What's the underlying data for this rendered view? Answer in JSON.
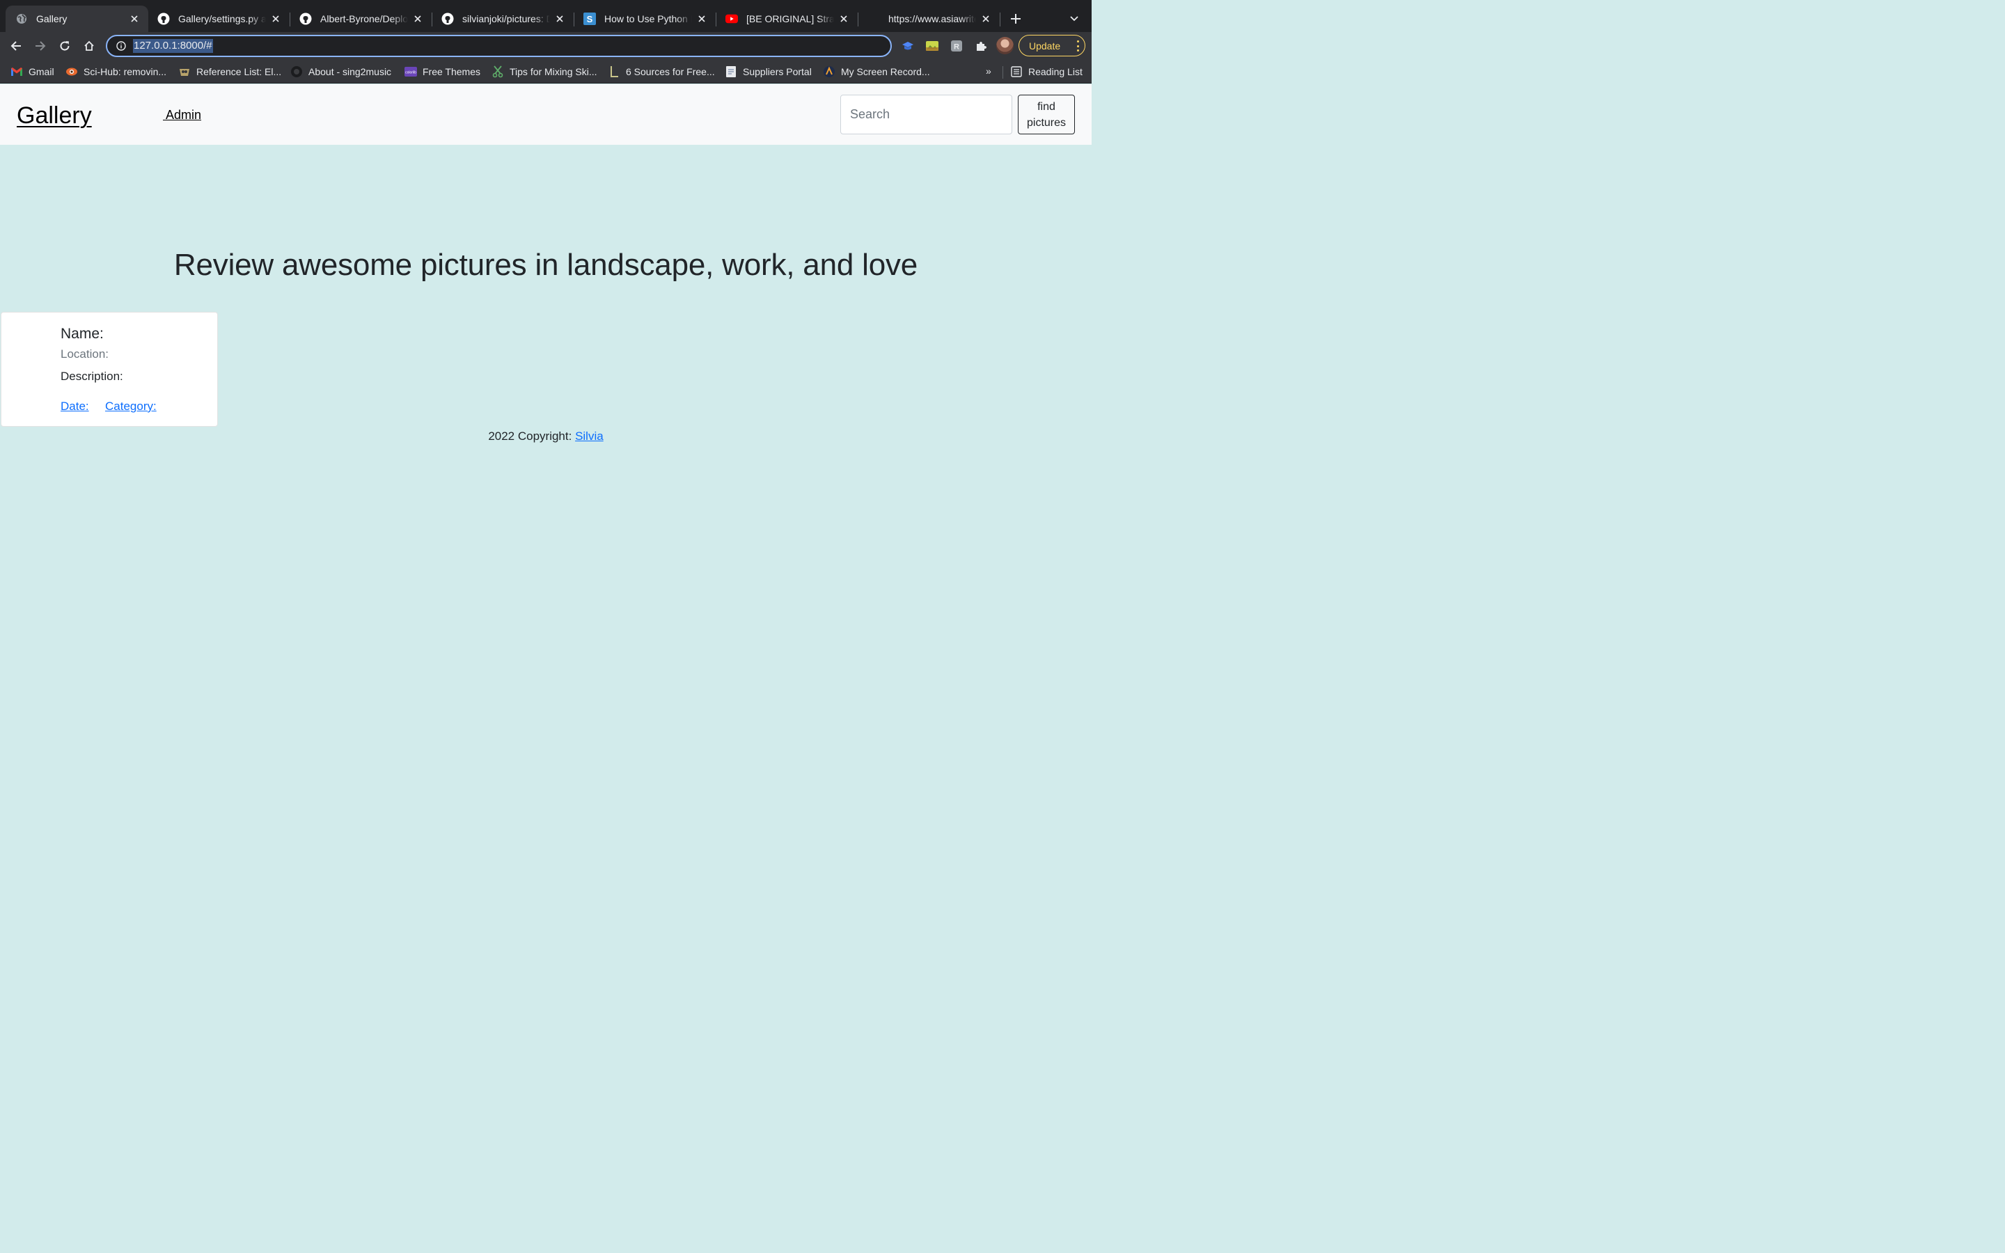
{
  "browser": {
    "tabs": [
      {
        "title": "Gallery",
        "icon": "globe-icon",
        "active": true
      },
      {
        "title": "Gallery/settings.py at",
        "icon": "github-icon"
      },
      {
        "title": "Albert-Byrone/Deploy",
        "icon": "github-icon"
      },
      {
        "title": "silvianjoki/pictures: Dj",
        "icon": "github-icon"
      },
      {
        "title": "How to Use Python D",
        "icon": "s-icon"
      },
      {
        "title": "[BE ORIGINAL] Stray",
        "icon": "youtube-icon"
      },
      {
        "title": "https://www.asiawrite",
        "icon": "blank-icon"
      }
    ],
    "url": "127.0.0.1:8000/#",
    "update_label": "Update",
    "bookmarks": [
      {
        "label": "Gmail",
        "icon": "gmail-icon"
      },
      {
        "label": "Sci-Hub: removin...",
        "icon": "scihub-icon"
      },
      {
        "label": "Reference List: El...",
        "icon": "owl-icon"
      },
      {
        "label": "About - sing2music",
        "icon": "circle-icon"
      },
      {
        "label": "Free Themes",
        "icon": "colorlib-icon"
      },
      {
        "label": "Tips for Mixing Ski...",
        "icon": "scissors-icon"
      },
      {
        "label": "6 Sources for Free...",
        "icon": "l-icon"
      },
      {
        "label": "Suppliers Portal",
        "icon": "doc-icon"
      },
      {
        "label": "My Screen Record...",
        "icon": "record-icon"
      }
    ],
    "bookmarks_more": "»",
    "reading_list": "Reading List"
  },
  "page": {
    "brand": "Gallery",
    "admin_link": " Admin",
    "search_placeholder": "Search",
    "find_button": "find pictures",
    "hero_title": "Review awesome pictures in landscape, work, and love",
    "card": {
      "name_label": "Name:",
      "location_label": "Location:",
      "description_label": "Description:",
      "date_link": "Date:",
      "category_link": "Category:"
    },
    "footer": {
      "text": "2022 Copyright: ",
      "author": "Silvia"
    }
  },
  "colors": {
    "page_bg": "#d2ebeb",
    "navbar_bg": "#f8f9fa",
    "link": "#0d6efd",
    "chrome_dark": "#202124",
    "chrome_toolbar": "#35363a",
    "update_accent": "#fdd663"
  }
}
